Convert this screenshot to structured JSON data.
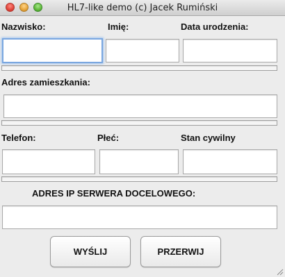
{
  "window": {
    "title": "HL7-like demo (c) Jacek Rumiński"
  },
  "form": {
    "surname_label": "Nazwisko:",
    "first_name_label": "Imię:",
    "birth_date_label": "Data urodzenia:",
    "address_label": "Adres zamieszkania:",
    "phone_label": "Telefon:",
    "sex_label": "Płeć:",
    "marital_label": "Stan cywilny",
    "server_ip_label": "ADRES IP SERWERA DOCELOWEGO:",
    "surname_value": "",
    "first_name_value": "",
    "birth_date_value": "",
    "address_value": "",
    "phone_value": "",
    "sex_value": "",
    "marital_value": "",
    "server_ip_value": ""
  },
  "buttons": {
    "send_label": "WYŚLIJ",
    "abort_label": "PRZERWIJ"
  },
  "colors": {
    "focus_ring": "#7aa7e0",
    "window_bg": "#ececec"
  }
}
